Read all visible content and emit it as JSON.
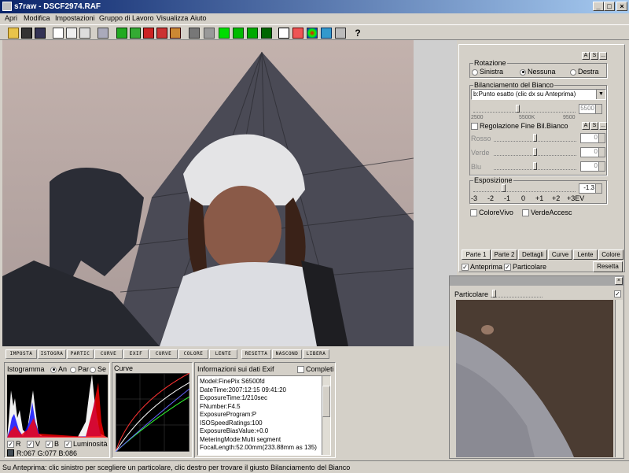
{
  "window": {
    "title": "s7raw - DSCF2974.RAF"
  },
  "menu": [
    "Apri",
    "Modifica",
    "Impostazioni",
    "Gruppo di Lavoro",
    "Visualizza",
    "Aiuto"
  ],
  "rotation": {
    "title": "Rotazione",
    "options": [
      "Sinistra",
      "Nessuna",
      "Destra"
    ],
    "selected": "Nessuna"
  },
  "white_balance": {
    "title": "Bilanciamento del Bianco",
    "dropdown": "b:Punto esatto (clic dx su Anteprima)",
    "value": "5500",
    "ticks": [
      "2500",
      "5500K",
      "9500"
    ],
    "fine_check": "Regolazione Fine Bil.Bianco",
    "rosso": "Rosso",
    "verde": "Verde",
    "blu": "Blu",
    "rosso_val": "0",
    "verde_val": "0",
    "blu_val": "0"
  },
  "exposure": {
    "title": "Esposizione",
    "value": "-1.3",
    "ticks": [
      "-3",
      "-2",
      "-1",
      "0",
      "+1",
      "+2",
      "+3EV"
    ]
  },
  "checks": {
    "colore_vivo": "ColoreVivo",
    "verde_accesc": "VerdeAccesc"
  },
  "as_buttons": [
    "A",
    "S",
    "..."
  ],
  "right_tabs": [
    "Parte 1",
    "Parte 2",
    "Dettagli",
    "Curve",
    "Lente",
    "Colore"
  ],
  "anteprima": "Anteprima",
  "particolare": "Particolare",
  "resetta": "Resetta",
  "bottom_tabs": [
    "IMPOSTA",
    "ISTOGRA",
    "PARTIC",
    "CURVE",
    "EXIF",
    "CURVE",
    "COLORE",
    "LENTE",
    "RESETTA",
    "NASCOND",
    "LIBERA"
  ],
  "histogram": {
    "title": "Istogramma",
    "options": [
      "An",
      "Par",
      "Se"
    ],
    "checks": [
      "R",
      "V",
      "B",
      "Luminosità"
    ],
    "rgb": "R:067 G:077 B:086"
  },
  "curve_title": "Curve",
  "exif": {
    "title": "Informazioni sui dati Exif",
    "completi": "Completi",
    "lines": [
      "Model:FinePix S6500fd",
      "DateTime:2007:12:15 09:41:20",
      "ExposureTime:1/210sec",
      "FNumber:F4.5",
      "ExposureProgram:P",
      "ISOSpeedRatings:100",
      "ExposureBiasValue:+0.0",
      "MeteringMode:Multi segment",
      "FocalLength:52.00mm(233.88mm as 135)"
    ]
  },
  "float_title": "Particolare",
  "status": "Su Anteprima: clic sinistro per scegliere un particolare, clic destro per trovare il giusto Bilanciamento del Bianco"
}
